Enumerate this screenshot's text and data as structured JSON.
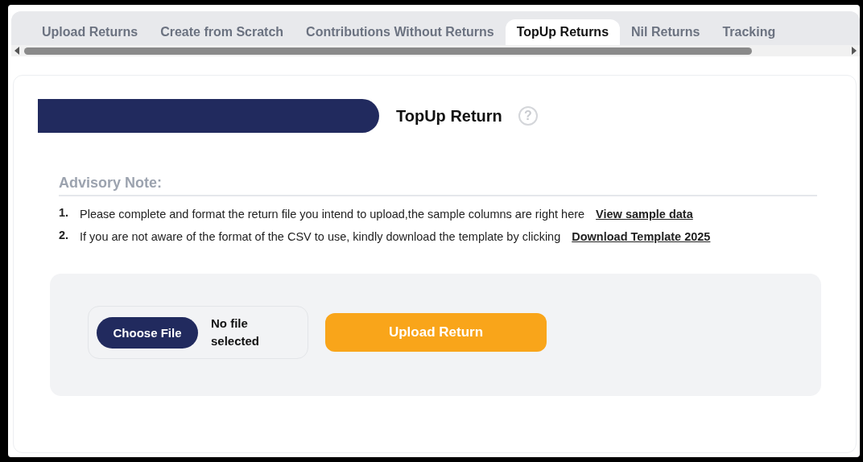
{
  "tabs": [
    {
      "label": "Upload Returns",
      "selected": false
    },
    {
      "label": "Create from Scratch",
      "selected": false
    },
    {
      "label": "Contributions Without Returns",
      "selected": false
    },
    {
      "label": "TopUp Returns",
      "selected": true
    },
    {
      "label": "Nil Returns",
      "selected": false
    },
    {
      "label": "Tracking",
      "selected": false
    }
  ],
  "panel": {
    "title": "TopUp Return",
    "help": "?",
    "advisory": {
      "heading": "Advisory Note:",
      "items": [
        {
          "number": "1.",
          "text": "Please complete and format the return file you intend to upload,the sample columns are right here",
          "link": "View sample data"
        },
        {
          "number": "2.",
          "text": "If you are not aware of the format of the CSV to use, kindly download the template by clicking",
          "link": "Download Template 2025"
        }
      ]
    },
    "upload": {
      "choose_button": "Choose File",
      "file_status": "No file selected",
      "upload_button": "Upload Return"
    }
  }
}
